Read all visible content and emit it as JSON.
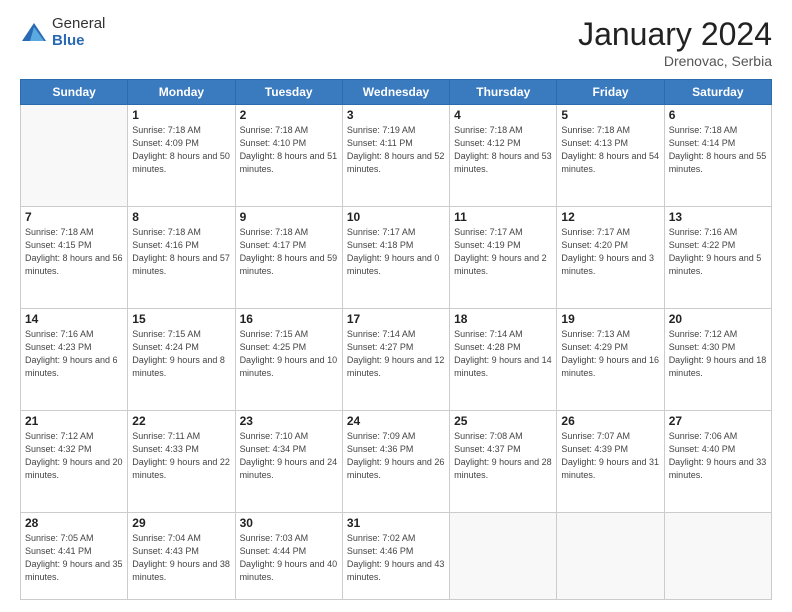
{
  "logo": {
    "general": "General",
    "blue": "Blue"
  },
  "header": {
    "month": "January 2024",
    "location": "Drenovac, Serbia"
  },
  "weekdays": [
    "Sunday",
    "Monday",
    "Tuesday",
    "Wednesday",
    "Thursday",
    "Friday",
    "Saturday"
  ],
  "weeks": [
    [
      {
        "day": "",
        "sunrise": "",
        "sunset": "",
        "daylight": ""
      },
      {
        "day": "1",
        "sunrise": "7:18 AM",
        "sunset": "4:09 PM",
        "daylight": "8 hours and 50 minutes."
      },
      {
        "day": "2",
        "sunrise": "7:18 AM",
        "sunset": "4:10 PM",
        "daylight": "8 hours and 51 minutes."
      },
      {
        "day": "3",
        "sunrise": "7:19 AM",
        "sunset": "4:11 PM",
        "daylight": "8 hours and 52 minutes."
      },
      {
        "day": "4",
        "sunrise": "7:18 AM",
        "sunset": "4:12 PM",
        "daylight": "8 hours and 53 minutes."
      },
      {
        "day": "5",
        "sunrise": "7:18 AM",
        "sunset": "4:13 PM",
        "daylight": "8 hours and 54 minutes."
      },
      {
        "day": "6",
        "sunrise": "7:18 AM",
        "sunset": "4:14 PM",
        "daylight": "8 hours and 55 minutes."
      }
    ],
    [
      {
        "day": "7",
        "sunrise": "7:18 AM",
        "sunset": "4:15 PM",
        "daylight": "8 hours and 56 minutes."
      },
      {
        "day": "8",
        "sunrise": "7:18 AM",
        "sunset": "4:16 PM",
        "daylight": "8 hours and 57 minutes."
      },
      {
        "day": "9",
        "sunrise": "7:18 AM",
        "sunset": "4:17 PM",
        "daylight": "8 hours and 59 minutes."
      },
      {
        "day": "10",
        "sunrise": "7:17 AM",
        "sunset": "4:18 PM",
        "daylight": "9 hours and 0 minutes."
      },
      {
        "day": "11",
        "sunrise": "7:17 AM",
        "sunset": "4:19 PM",
        "daylight": "9 hours and 2 minutes."
      },
      {
        "day": "12",
        "sunrise": "7:17 AM",
        "sunset": "4:20 PM",
        "daylight": "9 hours and 3 minutes."
      },
      {
        "day": "13",
        "sunrise": "7:16 AM",
        "sunset": "4:22 PM",
        "daylight": "9 hours and 5 minutes."
      }
    ],
    [
      {
        "day": "14",
        "sunrise": "7:16 AM",
        "sunset": "4:23 PM",
        "daylight": "9 hours and 6 minutes."
      },
      {
        "day": "15",
        "sunrise": "7:15 AM",
        "sunset": "4:24 PM",
        "daylight": "9 hours and 8 minutes."
      },
      {
        "day": "16",
        "sunrise": "7:15 AM",
        "sunset": "4:25 PM",
        "daylight": "9 hours and 10 minutes."
      },
      {
        "day": "17",
        "sunrise": "7:14 AM",
        "sunset": "4:27 PM",
        "daylight": "9 hours and 12 minutes."
      },
      {
        "day": "18",
        "sunrise": "7:14 AM",
        "sunset": "4:28 PM",
        "daylight": "9 hours and 14 minutes."
      },
      {
        "day": "19",
        "sunrise": "7:13 AM",
        "sunset": "4:29 PM",
        "daylight": "9 hours and 16 minutes."
      },
      {
        "day": "20",
        "sunrise": "7:12 AM",
        "sunset": "4:30 PM",
        "daylight": "9 hours and 18 minutes."
      }
    ],
    [
      {
        "day": "21",
        "sunrise": "7:12 AM",
        "sunset": "4:32 PM",
        "daylight": "9 hours and 20 minutes."
      },
      {
        "day": "22",
        "sunrise": "7:11 AM",
        "sunset": "4:33 PM",
        "daylight": "9 hours and 22 minutes."
      },
      {
        "day": "23",
        "sunrise": "7:10 AM",
        "sunset": "4:34 PM",
        "daylight": "9 hours and 24 minutes."
      },
      {
        "day": "24",
        "sunrise": "7:09 AM",
        "sunset": "4:36 PM",
        "daylight": "9 hours and 26 minutes."
      },
      {
        "day": "25",
        "sunrise": "7:08 AM",
        "sunset": "4:37 PM",
        "daylight": "9 hours and 28 minutes."
      },
      {
        "day": "26",
        "sunrise": "7:07 AM",
        "sunset": "4:39 PM",
        "daylight": "9 hours and 31 minutes."
      },
      {
        "day": "27",
        "sunrise": "7:06 AM",
        "sunset": "4:40 PM",
        "daylight": "9 hours and 33 minutes."
      }
    ],
    [
      {
        "day": "28",
        "sunrise": "7:05 AM",
        "sunset": "4:41 PM",
        "daylight": "9 hours and 35 minutes."
      },
      {
        "day": "29",
        "sunrise": "7:04 AM",
        "sunset": "4:43 PM",
        "daylight": "9 hours and 38 minutes."
      },
      {
        "day": "30",
        "sunrise": "7:03 AM",
        "sunset": "4:44 PM",
        "daylight": "9 hours and 40 minutes."
      },
      {
        "day": "31",
        "sunrise": "7:02 AM",
        "sunset": "4:46 PM",
        "daylight": "9 hours and 43 minutes."
      },
      {
        "day": "",
        "sunrise": "",
        "sunset": "",
        "daylight": ""
      },
      {
        "day": "",
        "sunrise": "",
        "sunset": "",
        "daylight": ""
      },
      {
        "day": "",
        "sunrise": "",
        "sunset": "",
        "daylight": ""
      }
    ]
  ],
  "labels": {
    "sunrise": "Sunrise:",
    "sunset": "Sunset:",
    "daylight": "Daylight:"
  }
}
